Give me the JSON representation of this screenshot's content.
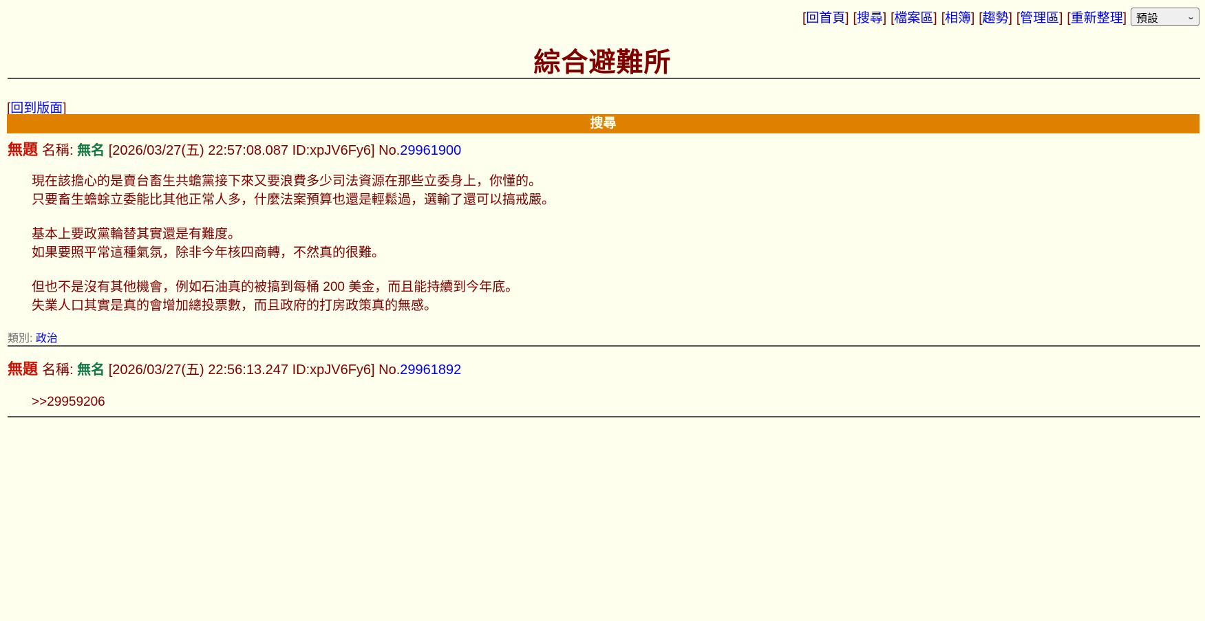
{
  "nav": {
    "links": [
      "回首頁",
      "搜尋",
      "檔案區",
      "相簿",
      "趨勢",
      "管理區",
      "重新整理"
    ],
    "style_select": {
      "selected": "預設",
      "icon": "chevron-down-icon"
    }
  },
  "board": {
    "title": "綜合避難所",
    "back_link": "回到版面",
    "bar_title": "搜尋"
  },
  "posts": [
    {
      "subject": "無題",
      "name_label": "名稱: ",
      "name": "無名",
      "datetime": " [2026/03/27(五) 22:57:08.087 ID:xpJV6Fy6] ",
      "no_label": "No.",
      "no": "29961900",
      "paragraphs": [
        [
          "現在該擔心的是賣台畜生共蟾黨接下來又要浪費多少司法資源在那些立委身上，你懂的。",
          "只要畜生蟾蜍立委能比其他正常人多，什麼法案預算也還是輕鬆過，選輸了還可以搞戒嚴。"
        ],
        [
          "基本上要政黨輪替其實還是有難度。",
          "如果要照平常這種氣氛，除非今年核四商轉，不然真的很難。"
        ],
        [
          "但也不是沒有其他機會，例如石油真的被搞到每桶 200 美金，而且能持續到今年底。",
          "失業人口其實是真的會增加總投票數，而且政府的打房政策真的無感。"
        ]
      ],
      "category_label": "類別: ",
      "category": "政治"
    },
    {
      "subject": "無題",
      "name_label": "名稱: ",
      "name": "無名",
      "datetime": " [2026/03/27(五) 22:56:13.247 ID:xpJV6Fy6] ",
      "no_label": "No.",
      "no": "29961892",
      "paragraphs": [
        [
          ">>29959206"
        ]
      ]
    }
  ],
  "colors": {
    "background": "#FFFFEE",
    "text": "#800000",
    "link": "#0000EE",
    "subject": "#CC1105",
    "name": "#117743",
    "bar": "#E08000"
  }
}
